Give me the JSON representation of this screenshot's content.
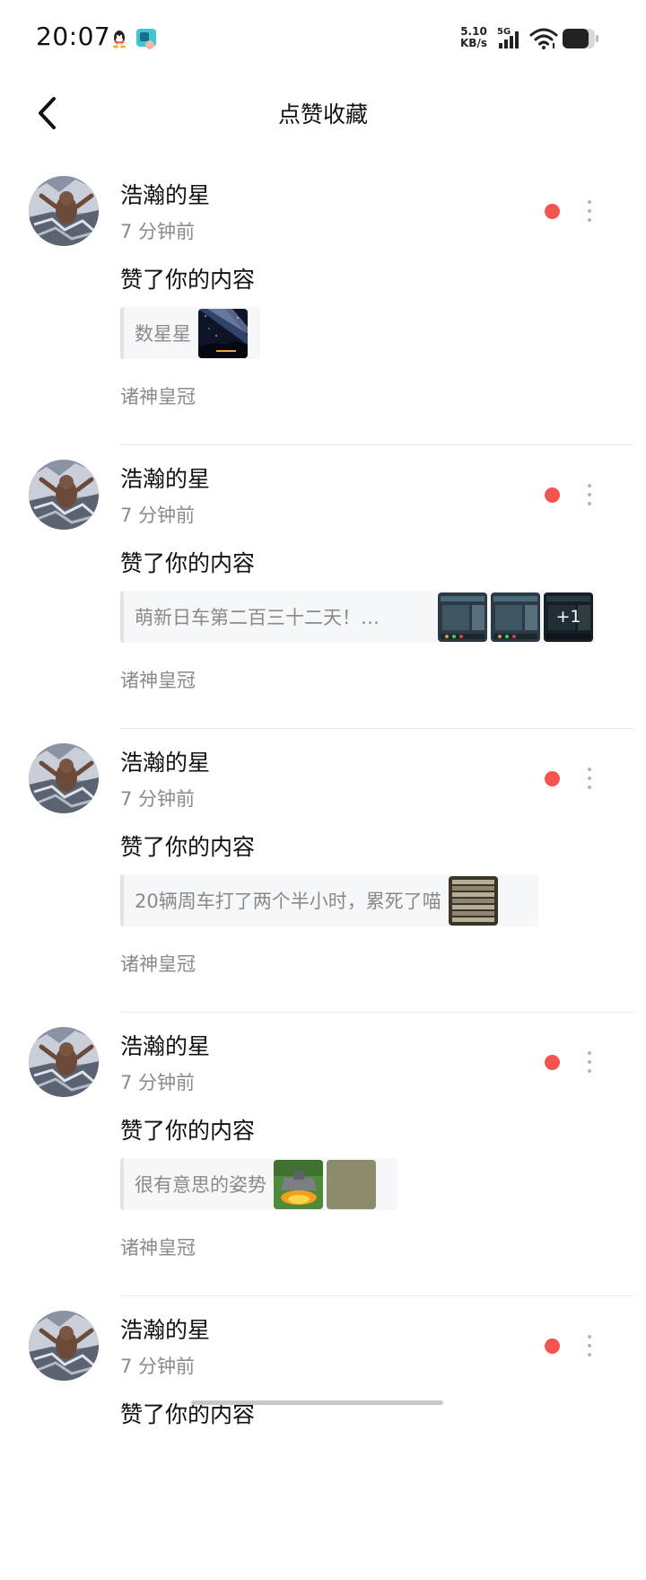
{
  "status_bar": {
    "time": "20:07",
    "net_speed_value": "5.10",
    "net_speed_unit": "KB/s",
    "network_type": "5G"
  },
  "header": {
    "title": "点赞收藏"
  },
  "notifications": [
    {
      "username": "浩瀚的星",
      "time": "7 分钟前",
      "action": "赞了你的内容",
      "content_text": "数星星",
      "thumbnails": [
        "starry-night"
      ],
      "extra_count": "",
      "source": "诸神皇冠"
    },
    {
      "username": "浩瀚的星",
      "time": "7 分钟前",
      "action": "赞了你的内容",
      "content_text": "萌新日车第二百三十二天！…",
      "thumbnails": [
        "game-screen",
        "game-screen",
        "game-screen"
      ],
      "extra_count": "+1",
      "source": "诸神皇冠"
    },
    {
      "username": "浩瀚的星",
      "time": "7 分钟前",
      "action": "赞了你的内容",
      "content_text": "20辆周车打了两个半小时，累死了喵",
      "thumbnails": [
        "game-list"
      ],
      "extra_count": "",
      "source": "诸神皇冠"
    },
    {
      "username": "浩瀚的星",
      "time": "7 分钟前",
      "action": "赞了你的内容",
      "content_text": "很有意思的姿势",
      "thumbnails": [
        "vehicle-fire",
        "olive-square"
      ],
      "extra_count": "",
      "source": "诸神皇冠"
    },
    {
      "username": "浩瀚的星",
      "time": "7 分钟前",
      "action": "赞了你的内容",
      "content_text": "",
      "thumbnails": [],
      "extra_count": "",
      "source": ""
    }
  ],
  "colors": {
    "unread_dot": "#f5534f",
    "secondary_text": "#8a8a8a",
    "card_background": "#f6f7f9"
  }
}
